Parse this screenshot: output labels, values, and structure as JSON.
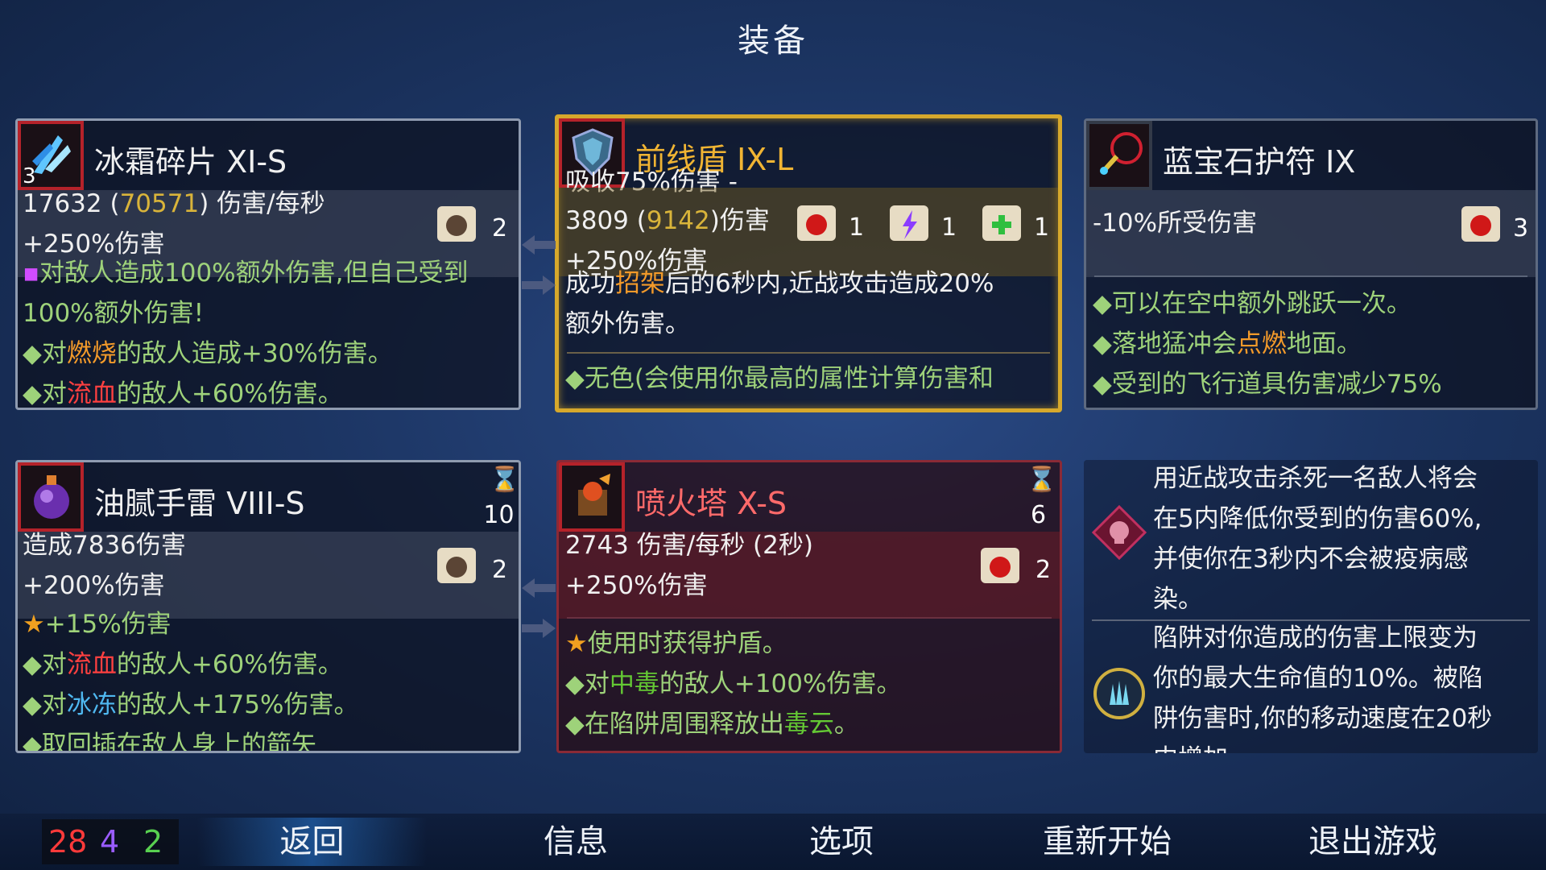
{
  "title": "装备",
  "cards": {
    "c1": {
      "level": "3",
      "name": "冰霜碎片 XI-S",
      "dps_a": "17632 (",
      "dps_b": "70571",
      "dps_c": ") 伤害/每秒",
      "bonus": "+250%伤害",
      "scroll_count": "2",
      "l1": "对敌人造成100%额外伤害,但自己受到",
      "l2": "100%额外伤害!",
      "l3a": "对",
      "l3b": "燃烧",
      "l3c": "的敌人造成+30%伤害。",
      "l4a": "对",
      "l4b": "流血",
      "l4c": "的敌人+60%伤害。"
    },
    "c2": {
      "name": "前线盾 IX-L",
      "absorb": "吸收75%伤害 -",
      "dmg_a": "3809 (",
      "dmg_b": "9142",
      "dmg_c": ")伤害",
      "s1": "1",
      "s2": "1",
      "s3": "1",
      "bonus": "+250%伤害",
      "l1a": "成功",
      "l1b": "招架",
      "l1c": "后的6秒内,近战攻击造成20%",
      "l2": "额外伤害。",
      "l3": "无色(会使用你最高的属性计算伤害和"
    },
    "c3": {
      "name": "蓝宝石护符 IX",
      "stat": "-10%所受伤害",
      "scroll_count": "3",
      "l1": "可以在空中额外跳跃一次。",
      "l2a": "落地猛冲会",
      "l2b": "点燃",
      "l2c": "地面。",
      "l3": "受到的飞行道具伤害减少75%"
    },
    "c4": {
      "name": "油腻手雷 VIII-S",
      "timer": "10",
      "dmg": "造成7836伤害",
      "bonus": "+200%伤害",
      "scroll_count": "2",
      "star": "+15%伤害",
      "l1a": "对",
      "l1b": "流血",
      "l1c": "的敌人+60%伤害。",
      "l2a": "对",
      "l2b": "冰冻",
      "l2c": "的敌人+175%伤害。",
      "l3": "取回插在敌人身上的箭矢"
    },
    "c5": {
      "name": "喷火塔 X-S",
      "timer": "6",
      "dps": "2743 伤害/每秒 (2秒)",
      "bonus": "+250%伤害",
      "scroll_count": "2",
      "star": "使用时获得护盾。",
      "l1a": "对",
      "l1b": "中毒",
      "l1c": "的敌人+100%伤害。",
      "l2a": "在陷阱周围释放出",
      "l2b": "毒云",
      "l2c": "。"
    },
    "c6": {
      "m1": [
        "用近战攻击杀死一名敌人将会",
        "在5内降低你受到的伤害60%,",
        "并使你在3秒内不会被疫病感",
        "染。"
      ],
      "m2": [
        "陷阱对你造成的伤害上限变为",
        "你的最大生命值的10%。被陷",
        "阱伤害时,你的移动速度在20秒",
        "内增加"
      ]
    }
  },
  "counts": {
    "red": "28",
    "purple": "4",
    "green": "2"
  },
  "nav": {
    "back": "返回",
    "info": "信息",
    "options": "选项",
    "restart": "重新开始",
    "quit": "退出游戏"
  },
  "colors": {
    "brutality": "#ff4040",
    "tactics": "#9a5cff",
    "survival": "#58d050",
    "gold_border": "#d6a82c"
  }
}
